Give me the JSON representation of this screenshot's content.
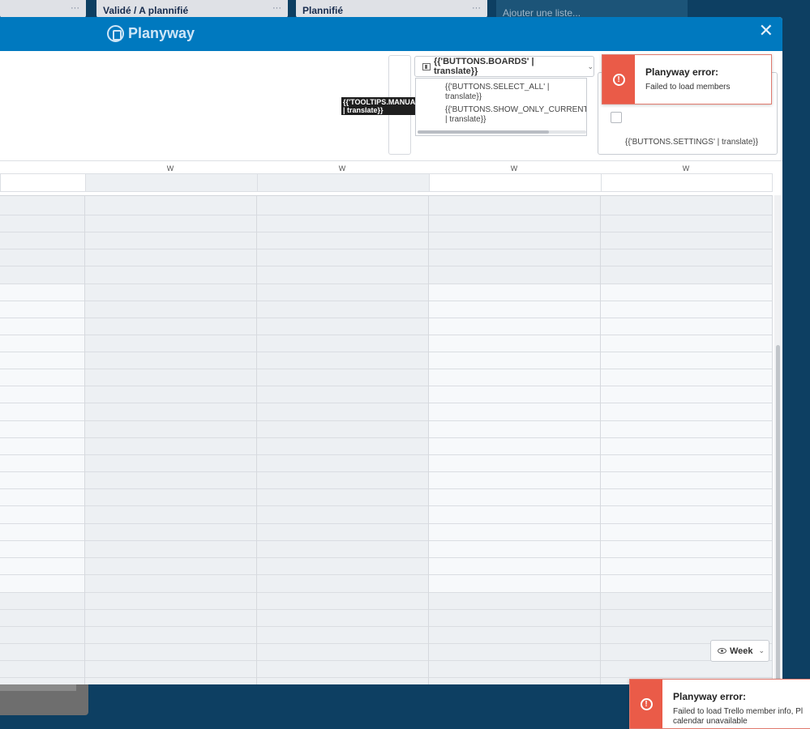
{
  "background": {
    "lists": [
      {
        "title": "",
        "dots": "···"
      },
      {
        "title": "Validé / A plannifié",
        "dots": "···"
      },
      {
        "title": "Plannifié",
        "dots": "···"
      }
    ],
    "add_list": "Ajouter une liste..."
  },
  "modal": {
    "brand": "Planyway",
    "close": "✕"
  },
  "toolbar": {
    "tooltip": "{{'TOOLTIPS.MANUAL_RELOAD'\n | translate}}",
    "boards_button": "{{'BUTTONS.BOARDS' | translate}}",
    "boards_options": [
      "{{'BUTTONS.SELECT_ALL' |\ntranslate}}",
      "{{'BUTTONS.SHOW_ONLY_CURRENT'\n| translate}}"
    ],
    "settings_label": "{{'BUTTONS.SETTINGS' | translate}}"
  },
  "calendar": {
    "day_headers": [
      "W",
      "W",
      "W",
      "W",
      "W"
    ],
    "view_button": "Week"
  },
  "toasts": [
    {
      "title": "Planyway error:",
      "message": "Failed to load members"
    },
    {
      "title": "Planyway error:",
      "message": "Failed to load Trello member info, Pl\ncalendar unavailable"
    }
  ],
  "colors": {
    "header": "#0079bf",
    "board_bg": "#0d3f62",
    "error": "#ea5b48"
  }
}
